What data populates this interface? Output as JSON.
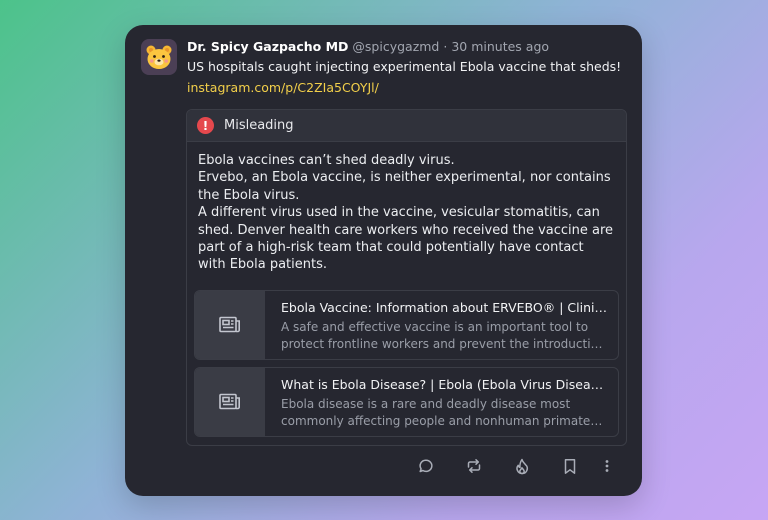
{
  "post": {
    "author_name": "Dr. Spicy Gazpacho MD",
    "handle": "@spicygazmd",
    "separator": "·",
    "time": "30 minutes ago",
    "text": "US hospitals caught injecting experimental Ebola vaccine that sheds!",
    "link": "instagram.com/p/C2ZIa5COYJl/",
    "avatar_icon": "bear-face-icon"
  },
  "note": {
    "label": "Misleading",
    "icon": "alert-icon",
    "lines": [
      "Ebola vaccines can’t shed deadly virus.",
      "Ervebo, an Ebola vaccine, is neither experimental, nor contains the Ebola virus.",
      "A different virus used in the vaccine, vesicular stomatitis, can shed. Denver health care workers who received the vaccine are part of a high-risk team that could potentially have contact with Ebola patients."
    ],
    "sources": [
      {
        "title": "Ebola Vaccine: Information about ERVEBO® | Clinician Resources",
        "description": "A safe and effective vaccine is an important tool to protect frontline workers and prevent the introduction of Ebola into the United States.",
        "icon": "newspaper-icon"
      },
      {
        "title": "What is Ebola Disease? | Ebola (Ebola Virus Disease) | CDC",
        "description": "Ebola disease is a rare and deadly disease most commonly affecting people and nonhuman primates in parts of Africa.",
        "icon": "newspaper-icon"
      }
    ]
  },
  "actions": [
    "reply-icon",
    "repost-icon",
    "flame-icon",
    "bookmark-icon",
    "more-icon"
  ],
  "colors": {
    "card_bg": "#262730",
    "link": "#f2cf4a",
    "alert": "#e5484d",
    "muted": "#a2a6b0"
  }
}
